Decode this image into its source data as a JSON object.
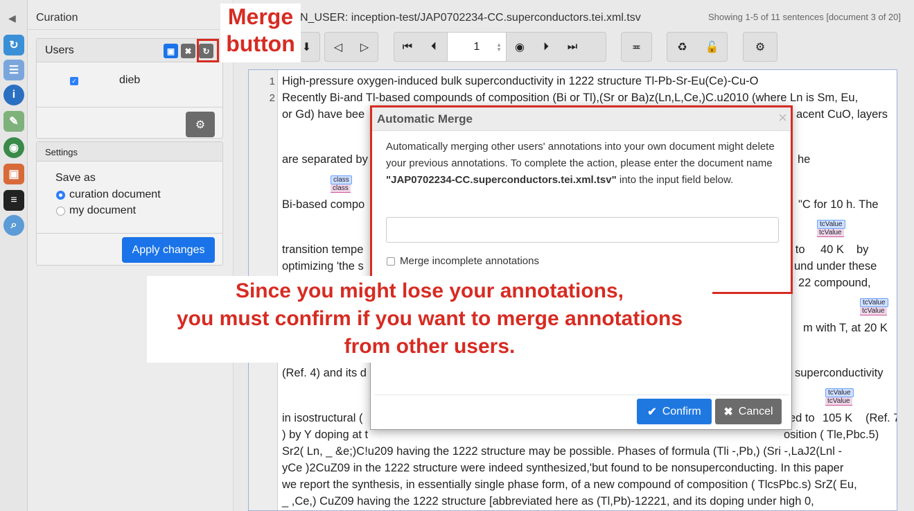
{
  "sidebar": {
    "title": "Curation",
    "users_panel": {
      "title": "Users",
      "users": [
        {
          "name": "dieb",
          "checked": true
        }
      ]
    },
    "settings_panel": {
      "title": "Settings",
      "save_as_label": "Save as",
      "options": [
        {
          "label": "curation document",
          "selected": true
        },
        {
          "label": "my document",
          "selected": false
        }
      ],
      "apply_label": "Apply changes"
    }
  },
  "main": {
    "title_visible": "N_USER: inception-test/JAP0702234-CC.superconductors.tei.xml.tsv",
    "showing": "Showing 1-5 of 11 sentences [document 3 of 20]",
    "page_number": "1"
  },
  "document": {
    "line_numbers": [
      "1",
      "2"
    ],
    "lines": [
      "High-pressure oxygen-induced bulk superconductivity in 1222 structure Tl-Pb-Sr-Eu(Ce)-Cu-O",
      "Recently Bi-and Tl-based compounds of composition (Bi or Tl),(Sr or Ba)z(Ln,L,Ce,)C.u2010 (where Ln is Sm, Eu,",
      "or Gd) have bee",
      "acent CuO, layers",
      "are separated by",
      "he",
      "Bi-based compo",
      "\"C for 10 h. The",
      "transition tempe",
      "d to",
      "by",
      "optimizing 'the s",
      "und under these",
      "22 compound,",
      "m with T, at",
      "(Ref. 4) and its d",
      "superconductivity",
      "in isostructural (",
      "ed to",
      "(Ref. 7",
      ") by Y doping at t",
      "osition ( Tle,Pbc.5)",
      "Sr2( Ln, _ &e;)C!u209 having the 1222 structure may be possible. Phases of formula (Tli -,Pb,) (Sri -,LaJ2(Lnl -",
      "yCe )2CuZ09 in the 1222 structure were indeed synthesized,'but found to be nonsuperconducting. In this paper",
      "we report the synthesis, in essentially single phase form, of a new compound of composition ( TlcsPbc.s) SrZ( Eu,",
      "_ ,Ce,) CuZ09 having the 1222 structure [abbreviated here as (Tl,Pb)-12221, and its doping under high 0,"
    ],
    "values": [
      "40 K",
      "20 K",
      "105 K"
    ],
    "annotations": [
      "class",
      "class",
      "tcValue",
      "tcValue",
      "tcValue",
      "tcValue",
      "tcValue",
      "tcValue"
    ]
  },
  "modal": {
    "title": "Automatic Merge",
    "close": "×",
    "body_prefix": "Automatically merging other users' annotations into your own document might delete your previous annotations. To complete the action, please enter the document name ",
    "doc_name": "\"JAP0702234-CC.superconductors.tei.xml.tsv\"",
    "body_suffix": " into the input field below.",
    "checkbox_label": "Merge incomplete annotations",
    "confirm_label": "Confirm",
    "cancel_label": "Cancel"
  },
  "callouts": {
    "merge_button_line1": "Merge",
    "merge_button_line2": "button",
    "warning_line1": "Since you might lose your annotations,",
    "warning_line2": "you must confirm if you want to merge annotations",
    "warning_line3": "from other users."
  },
  "colors": {
    "accent": "#1a73e8",
    "callout_red": "#d72b22",
    "annotation_blue": "#cfe0ff"
  },
  "icons": [
    "collapse-icon",
    "sync-icon",
    "layout-icon",
    "info-icon",
    "tag-icon",
    "globe-icon",
    "layers-icon",
    "comment-icon",
    "search-icon",
    "save-icon",
    "trash-icon",
    "refresh-icon",
    "gear-icon",
    "first-page-icon",
    "prev-page-icon",
    "eye-icon",
    "next-page-icon",
    "last-page-icon",
    "align-icon",
    "recycle-icon",
    "unlock-icon",
    "check-icon",
    "x-icon"
  ]
}
